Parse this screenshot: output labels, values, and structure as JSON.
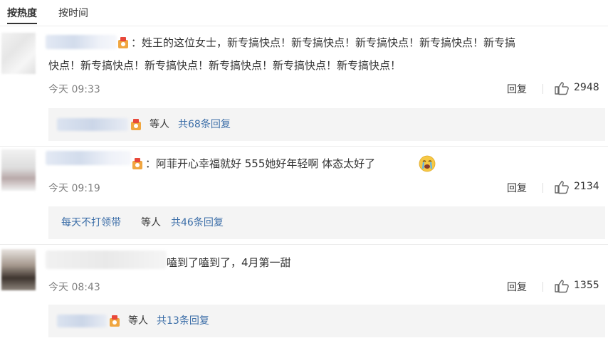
{
  "sort_tabs": {
    "hot": "按热度",
    "time": "按时间"
  },
  "comments": [
    {
      "text_line1": "：姓王的这位女士，新专搞快点！新专搞快点！新专搞快点！新专搞快点！新专搞",
      "text_line2": "快点！新专搞快点！新专搞快点！新专搞快点！新专搞快点！新专搞快点！",
      "time": "今天 09:33",
      "reply_label": "回复",
      "likes": "2948",
      "sub": {
        "prefix": "",
        "etc": "等人",
        "count_link": "共68条回复"
      }
    },
    {
      "text_line1": "：阿菲开心幸福就好 555她好年轻啊 体态太好了",
      "time": "今天 09:19",
      "reply_label": "回复",
      "likes": "2134",
      "sub": {
        "prefix": "每天不打领带",
        "etc": "等人",
        "count_link": "共46条回复"
      }
    },
    {
      "text_line1": "嗑到了嗑到了，4月第一甜",
      "time": "今天 08:43",
      "reply_label": "回复",
      "likes": "1355",
      "sub": {
        "prefix": "",
        "etc": "等人",
        "count_link": "共13条回复"
      }
    }
  ],
  "colors": {
    "link": "#3c6ea8",
    "text": "#333333",
    "muted": "#808080",
    "sub_bg": "#f4f4f4"
  }
}
